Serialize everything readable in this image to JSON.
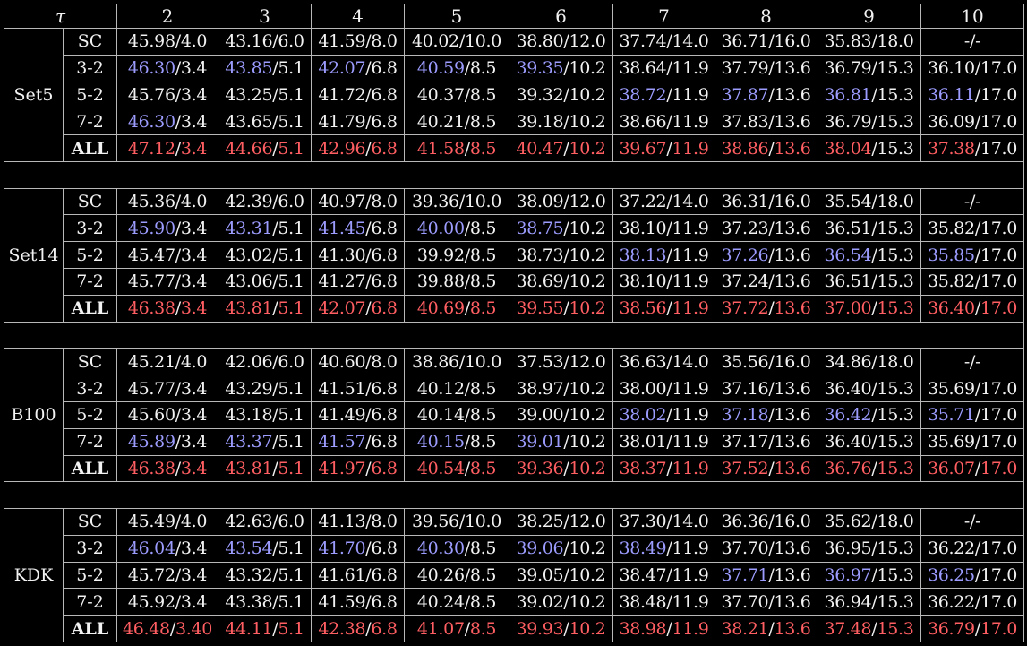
{
  "header": {
    "tau": "τ",
    "columns": [
      "2",
      "3",
      "4",
      "5",
      "6",
      "7",
      "8",
      "9",
      "10"
    ]
  },
  "colors": {
    "blue": "#9c9cff",
    "red": "#ff5e62",
    "normal": "#f2f2f2"
  },
  "datasets": [
    {
      "name": "Set5",
      "rows": [
        {
          "method": "SC",
          "cells": [
            {
              "a": "45.98",
              "b": "4.0"
            },
            {
              "a": "43.16",
              "b": "6.0"
            },
            {
              "a": "41.59",
              "b": "8.0"
            },
            {
              "a": "40.02",
              "b": "10.0"
            },
            {
              "a": "38.80",
              "b": "12.0"
            },
            {
              "a": "37.74",
              "b": "14.0"
            },
            {
              "a": "36.71",
              "b": "16.0"
            },
            {
              "a": "35.83",
              "b": "18.0"
            },
            {
              "text": "-/-"
            }
          ]
        },
        {
          "method": "3-2",
          "cells": [
            {
              "a": "46.30",
              "b": "3.4",
              "ac": "blue"
            },
            {
              "a": "43.85",
              "b": "5.1",
              "ac": "blue"
            },
            {
              "a": "42.07",
              "b": "6.8",
              "ac": "blue"
            },
            {
              "a": "40.59",
              "b": "8.5",
              "ac": "blue"
            },
            {
              "a": "39.35",
              "b": "10.2",
              "ac": "blue"
            },
            {
              "a": "38.64",
              "b": "11.9"
            },
            {
              "a": "37.79",
              "b": "13.6"
            },
            {
              "a": "36.79",
              "b": "15.3"
            },
            {
              "a": "36.10",
              "b": "17.0"
            }
          ]
        },
        {
          "method": "5-2",
          "cells": [
            {
              "a": "45.76",
              "b": "3.4"
            },
            {
              "a": "43.25",
              "b": "5.1"
            },
            {
              "a": "41.72",
              "b": "6.8"
            },
            {
              "a": "40.37",
              "b": "8.5"
            },
            {
              "a": "39.32",
              "b": "10.2"
            },
            {
              "a": "38.72",
              "b": "11.9",
              "ac": "blue"
            },
            {
              "a": "37.87",
              "b": "13.6",
              "ac": "blue"
            },
            {
              "a": "36.81",
              "b": "15.3",
              "ac": "blue"
            },
            {
              "a": "36.11",
              "b": "17.0",
              "ac": "blue"
            }
          ]
        },
        {
          "method": "7-2",
          "cells": [
            {
              "a": "46.30",
              "b": "3.4",
              "ac": "blue"
            },
            {
              "a": "43.65",
              "b": "5.1"
            },
            {
              "a": "41.79",
              "b": "6.8"
            },
            {
              "a": "40.21",
              "b": "8.5"
            },
            {
              "a": "39.18",
              "b": "10.2"
            },
            {
              "a": "38.66",
              "b": "11.9"
            },
            {
              "a": "37.83",
              "b": "13.6"
            },
            {
              "a": "36.79",
              "b": "15.3"
            },
            {
              "a": "36.09",
              "b": "17.0"
            }
          ]
        },
        {
          "method": "ALL",
          "bold": true,
          "cells": [
            {
              "a": "47.12",
              "b": "3.4",
              "ac": "red",
              "bc": "red"
            },
            {
              "a": "44.66",
              "b": "5.1",
              "ac": "red",
              "bc": "red"
            },
            {
              "a": "42.96",
              "b": "6.8",
              "ac": "red",
              "bc": "red"
            },
            {
              "a": "41.58",
              "b": "8.5",
              "ac": "red",
              "bc": "red"
            },
            {
              "a": "40.47",
              "b": "10.2",
              "ac": "red",
              "bc": "red"
            },
            {
              "a": "39.67",
              "b": "11.9",
              "ac": "red",
              "bc": "red"
            },
            {
              "a": "38.86",
              "b": "13.6",
              "ac": "red",
              "bc": "red"
            },
            {
              "a": "38.04",
              "b": "15.3",
              "ac": "red"
            },
            {
              "a": "37.38",
              "b": "17.0",
              "ac": "red"
            }
          ]
        }
      ]
    },
    {
      "name": "Set14",
      "rows": [
        {
          "method": "SC",
          "cells": [
            {
              "a": "45.36",
              "b": "4.0"
            },
            {
              "a": "42.39",
              "b": "6.0"
            },
            {
              "a": "40.97",
              "b": "8.0"
            },
            {
              "a": "39.36",
              "b": "10.0"
            },
            {
              "a": "38.09",
              "b": "12.0"
            },
            {
              "a": "37.22",
              "b": "14.0"
            },
            {
              "a": "36.31",
              "b": "16.0"
            },
            {
              "a": "35.54",
              "b": "18.0"
            },
            {
              "text": "-/-"
            }
          ]
        },
        {
          "method": "3-2",
          "cells": [
            {
              "a": "45.90",
              "b": "3.4",
              "ac": "blue"
            },
            {
              "a": "43.31",
              "b": "5.1",
              "ac": "blue"
            },
            {
              "a": "41.45",
              "b": "6.8",
              "ac": "blue"
            },
            {
              "a": "40.00",
              "b": "8.5",
              "ac": "blue"
            },
            {
              "a": "38.75",
              "b": "10.2",
              "ac": "blue"
            },
            {
              "a": "38.10",
              "b": "11.9"
            },
            {
              "a": "37.23",
              "b": "13.6"
            },
            {
              "a": "36.51",
              "b": "15.3"
            },
            {
              "a": "35.82",
              "b": "17.0"
            }
          ]
        },
        {
          "method": "5-2",
          "cells": [
            {
              "a": "45.47",
              "b": "3.4"
            },
            {
              "a": "43.02",
              "b": "5.1"
            },
            {
              "a": "41.30",
              "b": "6.8"
            },
            {
              "a": "39.92",
              "b": "8.5"
            },
            {
              "a": "38.73",
              "b": "10.2"
            },
            {
              "a": "38.13",
              "b": "11.9",
              "ac": "blue"
            },
            {
              "a": "37.26",
              "b": "13.6",
              "ac": "blue"
            },
            {
              "a": "36.54",
              "b": "15.3",
              "ac": "blue"
            },
            {
              "a": "35.85",
              "b": "17.0",
              "ac": "blue"
            }
          ]
        },
        {
          "method": "7-2",
          "cells": [
            {
              "a": "45.77",
              "b": "3.4"
            },
            {
              "a": "43.06",
              "b": "5.1"
            },
            {
              "a": "41.27",
              "b": "6.8"
            },
            {
              "a": "39.88",
              "b": "8.5"
            },
            {
              "a": "38.69",
              "b": "10.2"
            },
            {
              "a": "38.10",
              "b": "11.9"
            },
            {
              "a": "37.24",
              "b": "13.6"
            },
            {
              "a": "36.51",
              "b": "15.3"
            },
            {
              "a": "35.82",
              "b": "17.0"
            }
          ]
        },
        {
          "method": "ALL",
          "bold": true,
          "cells": [
            {
              "a": "46.38",
              "b": "3.4",
              "ac": "red",
              "bc": "red"
            },
            {
              "a": "43.81",
              "b": "5.1",
              "ac": "red",
              "bc": "red"
            },
            {
              "a": "42.07",
              "b": "6.8",
              "ac": "red",
              "bc": "red"
            },
            {
              "a": "40.69",
              "b": "8.5",
              "ac": "red",
              "bc": "red"
            },
            {
              "a": "39.55",
              "b": "10.2",
              "ac": "red",
              "bc": "red"
            },
            {
              "a": "38.56",
              "b": "11.9",
              "ac": "red",
              "bc": "red"
            },
            {
              "a": "37.72",
              "b": "13.6",
              "ac": "red",
              "bc": "red"
            },
            {
              "a": "37.00",
              "b": "15.3",
              "ac": "red",
              "bc": "red"
            },
            {
              "a": "36.40",
              "b": "17.0",
              "ac": "red",
              "bc": "red"
            }
          ]
        }
      ]
    },
    {
      "name": "B100",
      "rows": [
        {
          "method": "SC",
          "cells": [
            {
              "a": "45.21",
              "b": "4.0"
            },
            {
              "a": "42.06",
              "b": "6.0"
            },
            {
              "a": "40.60",
              "b": "8.0"
            },
            {
              "a": "38.86",
              "b": "10.0"
            },
            {
              "a": "37.53",
              "b": "12.0"
            },
            {
              "a": "36.63",
              "b": "14.0"
            },
            {
              "a": "35.56",
              "b": "16.0"
            },
            {
              "a": "34.86",
              "b": "18.0"
            },
            {
              "text": "-/-"
            }
          ]
        },
        {
          "method": "3-2",
          "cells": [
            {
              "a": "45.77",
              "b": "3.4"
            },
            {
              "a": "43.29",
              "b": "5.1"
            },
            {
              "a": "41.51",
              "b": "6.8"
            },
            {
              "a": "40.12",
              "b": "8.5"
            },
            {
              "a": "38.97",
              "b": "10.2"
            },
            {
              "a": "38.00",
              "b": "11.9"
            },
            {
              "a": "37.16",
              "b": "13.6"
            },
            {
              "a": "36.40",
              "b": "15.3"
            },
            {
              "a": "35.69",
              "b": "17.0"
            }
          ]
        },
        {
          "method": "5-2",
          "cells": [
            {
              "a": "45.60",
              "b": "3.4"
            },
            {
              "a": "43.18",
              "b": "5.1"
            },
            {
              "a": "41.49",
              "b": "6.8"
            },
            {
              "a": "40.14",
              "b": "8.5"
            },
            {
              "a": "39.00",
              "b": "10.2"
            },
            {
              "a": "38.02",
              "b": "11.9",
              "ac": "blue"
            },
            {
              "a": "37.18",
              "b": "13.6",
              "ac": "blue"
            },
            {
              "a": "36.42",
              "b": "15.3",
              "ac": "blue"
            },
            {
              "a": "35.71",
              "b": "17.0",
              "ac": "blue"
            }
          ]
        },
        {
          "method": "7-2",
          "cells": [
            {
              "a": "45.89",
              "b": "3.4",
              "ac": "blue"
            },
            {
              "a": "43.37",
              "b": "5.1",
              "ac": "blue"
            },
            {
              "a": "41.57",
              "b": "6.8",
              "ac": "blue"
            },
            {
              "a": "40.15",
              "b": "8.5",
              "ac": "blue"
            },
            {
              "a": "39.01",
              "b": "10.2",
              "ac": "blue"
            },
            {
              "a": "38.01",
              "b": "11.9"
            },
            {
              "a": "37.17",
              "b": "13.6"
            },
            {
              "a": "36.40",
              "b": "15.3"
            },
            {
              "a": "35.69",
              "b": "17.0"
            }
          ]
        },
        {
          "method": "ALL",
          "bold": true,
          "cells": [
            {
              "a": "46.38",
              "b": "3.4",
              "ac": "red",
              "bc": "red"
            },
            {
              "a": "43.81",
              "b": "5.1",
              "ac": "red",
              "bc": "red"
            },
            {
              "a": "41.97",
              "b": "6.8",
              "ac": "red",
              "bc": "red"
            },
            {
              "a": "40.54",
              "b": "8.5",
              "ac": "red",
              "bc": "red"
            },
            {
              "a": "39.36",
              "b": "10.2",
              "ac": "red",
              "bc": "red"
            },
            {
              "a": "38.37",
              "b": "11.9",
              "ac": "red",
              "bc": "red"
            },
            {
              "a": "37.52",
              "b": "13.6",
              "ac": "red",
              "bc": "red"
            },
            {
              "a": "36.76",
              "b": "15.3",
              "ac": "red",
              "bc": "red"
            },
            {
              "a": "36.07",
              "b": "17.0",
              "ac": "red",
              "bc": "red"
            }
          ]
        }
      ]
    },
    {
      "name": "KDK",
      "rows": [
        {
          "method": "SC",
          "cells": [
            {
              "a": "45.49",
              "b": "4.0"
            },
            {
              "a": "42.63",
              "b": "6.0"
            },
            {
              "a": "41.13",
              "b": "8.0"
            },
            {
              "a": "39.56",
              "b": "10.0"
            },
            {
              "a": "38.25",
              "b": "12.0"
            },
            {
              "a": "37.30",
              "b": "14.0"
            },
            {
              "a": "36.36",
              "b": "16.0"
            },
            {
              "a": "35.62",
              "b": "18.0"
            },
            {
              "text": "-/-"
            }
          ]
        },
        {
          "method": "3-2",
          "cells": [
            {
              "a": "46.04",
              "b": "3.4",
              "ac": "blue"
            },
            {
              "a": "43.54",
              "b": "5.1",
              "ac": "blue"
            },
            {
              "a": "41.70",
              "b": "6.8",
              "ac": "blue"
            },
            {
              "a": "40.30",
              "b": "8.5",
              "ac": "blue"
            },
            {
              "a": "39.06",
              "b": "10.2",
              "ac": "blue"
            },
            {
              "a": "38.49",
              "b": "11.9",
              "ac": "blue"
            },
            {
              "a": "37.70",
              "b": "13.6"
            },
            {
              "a": "36.95",
              "b": "15.3"
            },
            {
              "a": "36.22",
              "b": "17.0"
            }
          ]
        },
        {
          "method": "5-2",
          "cells": [
            {
              "a": "45.72",
              "b": "3.4"
            },
            {
              "a": "43.32",
              "b": "5.1"
            },
            {
              "a": "41.61",
              "b": "6.8"
            },
            {
              "a": "40.26",
              "b": "8.5"
            },
            {
              "a": "39.05",
              "b": "10.2"
            },
            {
              "a": "38.47",
              "b": "11.9"
            },
            {
              "a": "37.71",
              "b": "13.6",
              "ac": "blue"
            },
            {
              "a": "36.97",
              "b": "15.3",
              "ac": "blue"
            },
            {
              "a": "36.25",
              "b": "17.0",
              "ac": "blue"
            }
          ]
        },
        {
          "method": "7-2",
          "cells": [
            {
              "a": "45.92",
              "b": "3.4"
            },
            {
              "a": "43.38",
              "b": "5.1"
            },
            {
              "a": "41.59",
              "b": "6.8"
            },
            {
              "a": "40.24",
              "b": "8.5"
            },
            {
              "a": "39.02",
              "b": "10.2"
            },
            {
              "a": "38.48",
              "b": "11.9"
            },
            {
              "a": "37.70",
              "b": "13.6"
            },
            {
              "a": "36.94",
              "b": "15.3"
            },
            {
              "a": "36.22",
              "b": "17.0"
            }
          ]
        },
        {
          "method": "ALL",
          "bold": true,
          "cells": [
            {
              "a": "46.48",
              "b": "3.40",
              "ac": "red",
              "bc": "red"
            },
            {
              "a": "44.11",
              "b": "5.1",
              "ac": "red",
              "bc": "red"
            },
            {
              "a": "42.38",
              "b": "6.8",
              "ac": "red",
              "bc": "red"
            },
            {
              "a": "41.07",
              "b": "8.5",
              "ac": "red",
              "bc": "red"
            },
            {
              "a": "39.93",
              "b": "10.2",
              "ac": "red",
              "bc": "red"
            },
            {
              "a": "38.98",
              "b": "11.9",
              "ac": "red",
              "bc": "red"
            },
            {
              "a": "38.21",
              "b": "13.6",
              "ac": "red",
              "bc": "red"
            },
            {
              "a": "37.48",
              "b": "15.3",
              "ac": "red",
              "bc": "red"
            },
            {
              "a": "36.79",
              "b": "17.0",
              "ac": "red",
              "bc": "red"
            }
          ]
        }
      ]
    }
  ]
}
